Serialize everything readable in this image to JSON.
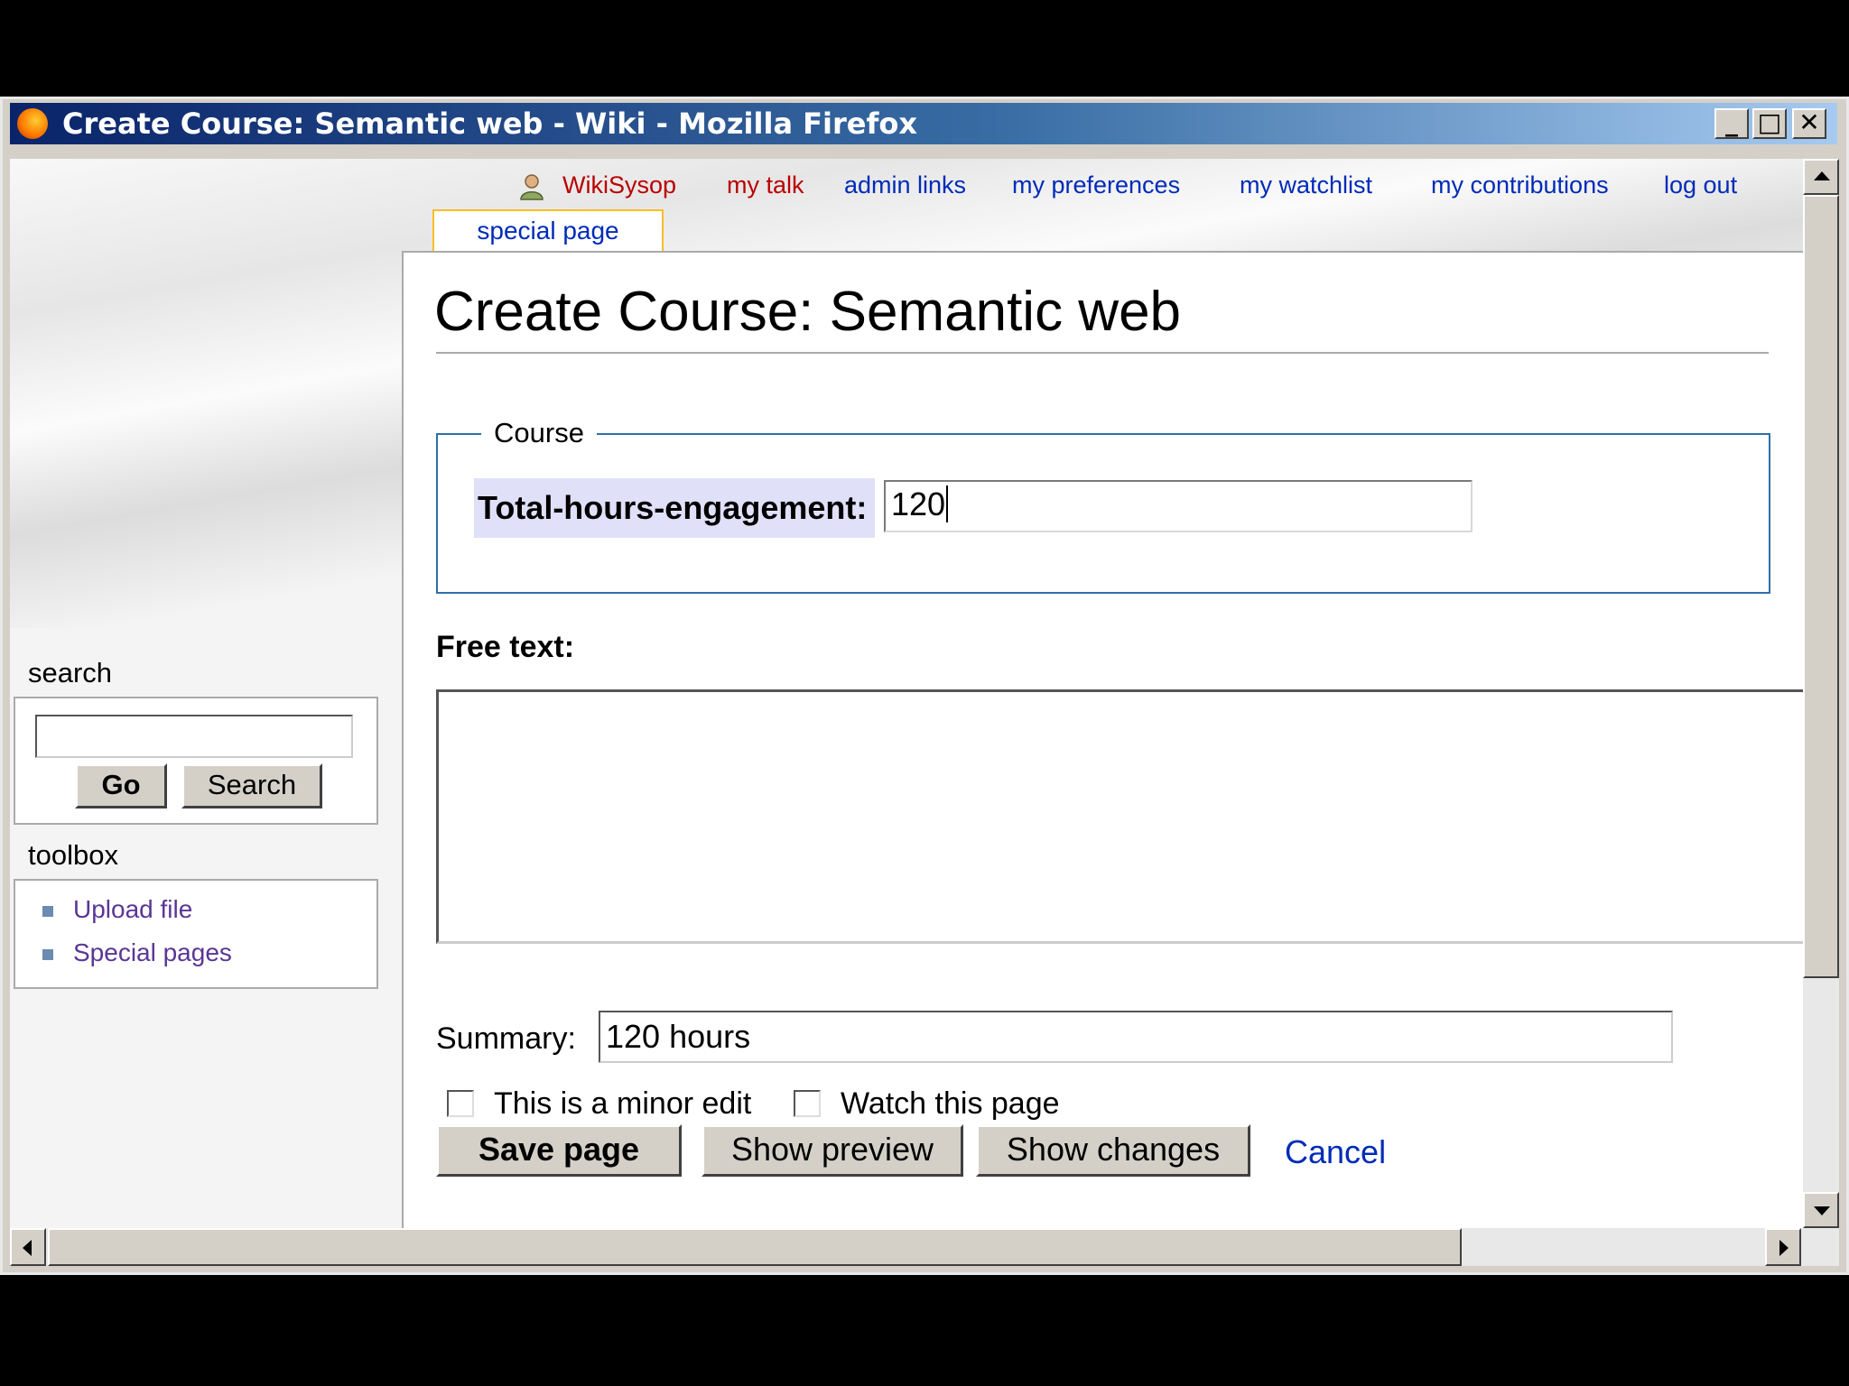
{
  "window": {
    "title": "Create Course: Semantic web - Wiki - Mozilla Firefox"
  },
  "personal_links": {
    "user": "WikiSysop",
    "talk": "my talk",
    "admin": "admin links",
    "preferences": "my preferences",
    "watchlist": "my watchlist",
    "contributions": "my contributions",
    "logout": "log out"
  },
  "tab": {
    "label": "special page"
  },
  "page": {
    "title": "Create Course: Semantic web"
  },
  "form": {
    "legend": "Course",
    "field_label": "Total-hours-engagement:",
    "field_value": "120",
    "free_text_label": "Free text:",
    "free_text_value": "",
    "summary_label": "Summary:",
    "summary_value": "120 hours",
    "minor_edit_label": "This is a minor edit",
    "watch_label": "Watch this page",
    "save_label": "Save page",
    "preview_label": "Show preview",
    "changes_label": "Show changes",
    "cancel_label": "Cancel"
  },
  "sidebar": {
    "search_heading": "search",
    "go_label": "Go",
    "search_label": "Search",
    "search_value": "",
    "toolbox_heading": "toolbox",
    "tools": [
      "Upload file",
      "Special pages"
    ]
  },
  "colors": {
    "link": "#002bb8",
    "new_link": "#ba0000",
    "visited": "#5a3696",
    "fieldset_border": "#2f6fab",
    "label_bg": "#e0e0f8",
    "tab_border": "#fabd23"
  }
}
